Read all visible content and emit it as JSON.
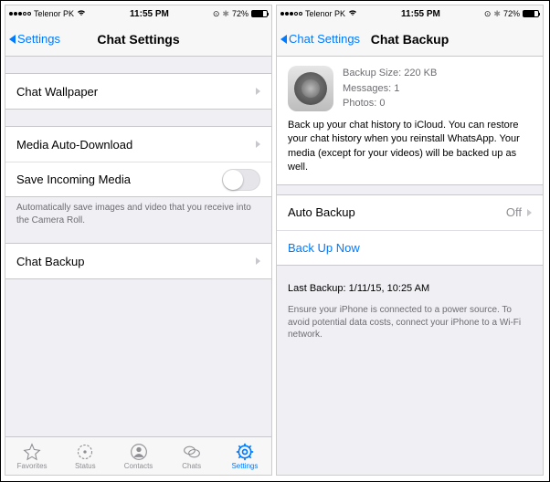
{
  "statusBar": {
    "carrier": "Telenor PK",
    "signalFilled": 3,
    "signalTotal": 5,
    "time": "11:55 PM",
    "batteryPct": "72%",
    "bluetooth": "✱",
    "alarm": "⚙"
  },
  "left": {
    "back": "Settings",
    "title": "Chat Settings",
    "rows": {
      "wallpaper": "Chat Wallpaper",
      "mediaAuto": "Media Auto-Download",
      "saveIncoming": "Save Incoming Media",
      "saveIncomingFooter": "Automatically save images and video that you receive into the Camera Roll.",
      "chatBackup": "Chat Backup"
    },
    "tabs": {
      "favorites": "Favorites",
      "status": "Status",
      "contacts": "Contacts",
      "chats": "Chats",
      "settings": "Settings"
    }
  },
  "right": {
    "back": "Chat Settings",
    "title": "Chat Backup",
    "backupSize": "Backup Size: 220 KB",
    "messages": "Messages: 1",
    "photos": "Photos: 0",
    "desc": "Back up your chat history to iCloud. You can restore your chat history when you reinstall WhatsApp. Your media (except for your videos) will be backed up as well.",
    "autoBackup": "Auto Backup",
    "autoBackupValue": "Off",
    "backupNow": "Back Up Now",
    "lastBackup": "Last Backup: 1/11/15, 10:25 AM",
    "ensure": "Ensure your iPhone is connected to a power source. To avoid potential data costs, connect your iPhone to a Wi-Fi network."
  }
}
